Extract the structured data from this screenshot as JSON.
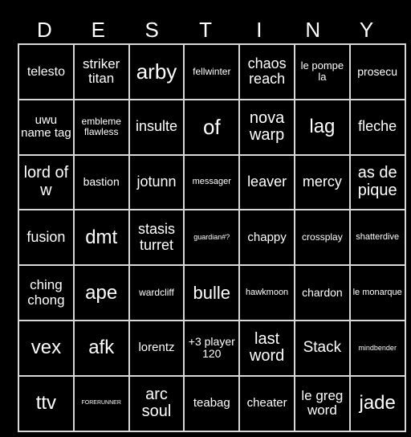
{
  "title_letters": [
    "D",
    "E",
    "S",
    "T",
    "I",
    "N",
    "Y"
  ],
  "board": [
    [
      "telesto",
      "striker titan",
      "arby",
      "fellwinter",
      "chaos reach",
      "le pompe la",
      "prosecu"
    ],
    [
      "uwu name tag",
      "embleme flawless",
      "insulte",
      "of",
      "nova warp",
      "lag",
      "fleche"
    ],
    [
      "lord of w",
      "bastion",
      "jotunn",
      "messager",
      "leaver",
      "mercy",
      "as de pique"
    ],
    [
      "fusion",
      "dmt",
      "stasis turret",
      "guardian#?",
      "chappy",
      "crossplay",
      "shatterdive"
    ],
    [
      "ching chong",
      "ape",
      "wardcliff",
      "bulle",
      "hawkmoon",
      "chardon",
      "le monarque"
    ],
    [
      "vex",
      "afk",
      "lorentz",
      "+3 player 120",
      "last word",
      "Stack",
      "mindbender"
    ],
    [
      "ttv",
      "FORERUNNER",
      "arc soul",
      "teabag",
      "cheater",
      "le greg word",
      "jade"
    ]
  ]
}
